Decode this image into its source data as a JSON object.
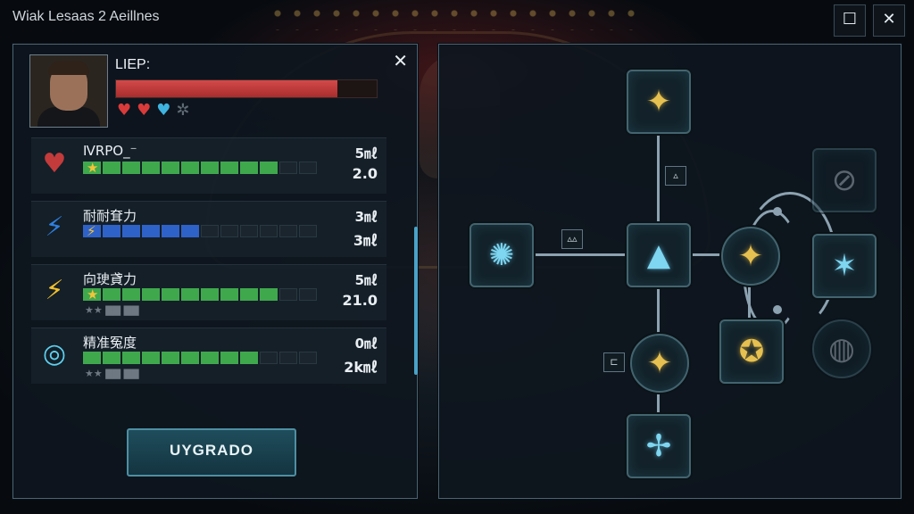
{
  "window": {
    "title": "Wiak Lesaas 2 Aeillnes",
    "maximize_icon": "maximize-icon",
    "close_icon": "close-icon"
  },
  "character": {
    "label": "LIEP:",
    "health_fraction": 0.85,
    "hearts": [
      {
        "icon": "heart-icon",
        "color": "#d93b3b"
      },
      {
        "icon": "heart-icon",
        "color": "#d93b3b"
      },
      {
        "icon": "heart-icon",
        "color": "#3fb4e0"
      },
      {
        "icon": "gear-icon",
        "color": "#5f6c76"
      }
    ]
  },
  "stats": [
    {
      "name": "ⅣRPO_⁻",
      "icon": "heart-icon",
      "icon_color": "#c33b3b",
      "val1": "5㎖",
      "val2": "2.0",
      "filled": 10,
      "total": 12,
      "bar_color": "#3fa84d",
      "badge": "star-icon",
      "sub": ""
    },
    {
      "name": "耐耐耷力",
      "icon": "lightning-icon",
      "icon_color": "#2f7fe0",
      "val1": "3㎖",
      "val2": "3㎖",
      "filled": 6,
      "total": 12,
      "bar_color": "#2f62c9",
      "badge": "lightning-icon",
      "sub": ""
    },
    {
      "name": "向㻀貣力",
      "icon": "lightning-icon",
      "icon_color": "#f0c02c",
      "val1": "5㎖",
      "val2": "21.0",
      "filled": 10,
      "total": 12,
      "bar_color": "#3fa84d",
      "badge": "star-icon",
      "sub": "★★ ▇▇ ▇▇"
    },
    {
      "name": "精准冤度",
      "icon": "target-icon",
      "icon_color": "#5fd0ef",
      "val1": "0㎖",
      "val2": "2k㎖",
      "filled": 9,
      "total": 12,
      "bar_color": "#3fa84d",
      "badge": "",
      "sub": "★★ ▇▇ ▇▇"
    }
  ],
  "upgrade_label": "UYGRADO",
  "panel_close": "✕",
  "skill_tree": {
    "nodes": [
      {
        "id": "top",
        "icon": "✦",
        "tone": "gold",
        "shape": "square"
      },
      {
        "id": "left",
        "icon": "✺",
        "tone": "blue",
        "shape": "square"
      },
      {
        "id": "center",
        "icon": "▲",
        "tone": "blue",
        "shape": "square"
      },
      {
        "id": "mid-right",
        "icon": "✦",
        "tone": "gold",
        "shape": "round"
      },
      {
        "id": "lower-mid",
        "icon": "✦",
        "tone": "gold",
        "shape": "round"
      },
      {
        "id": "bottom",
        "icon": "✢",
        "tone": "blue",
        "shape": "square"
      },
      {
        "id": "right-top",
        "icon": "⊘",
        "tone": "grey",
        "shape": "square"
      },
      {
        "id": "right-mid",
        "icon": "✶",
        "tone": "blue",
        "shape": "square"
      },
      {
        "id": "right-bottom",
        "icon": "◍",
        "tone": "grey",
        "shape": "round"
      },
      {
        "id": "right-lower",
        "icon": "✪",
        "tone": "gold",
        "shape": "square"
      }
    ],
    "mini_badges": [
      "▵",
      "▵▵",
      "⊏"
    ]
  }
}
